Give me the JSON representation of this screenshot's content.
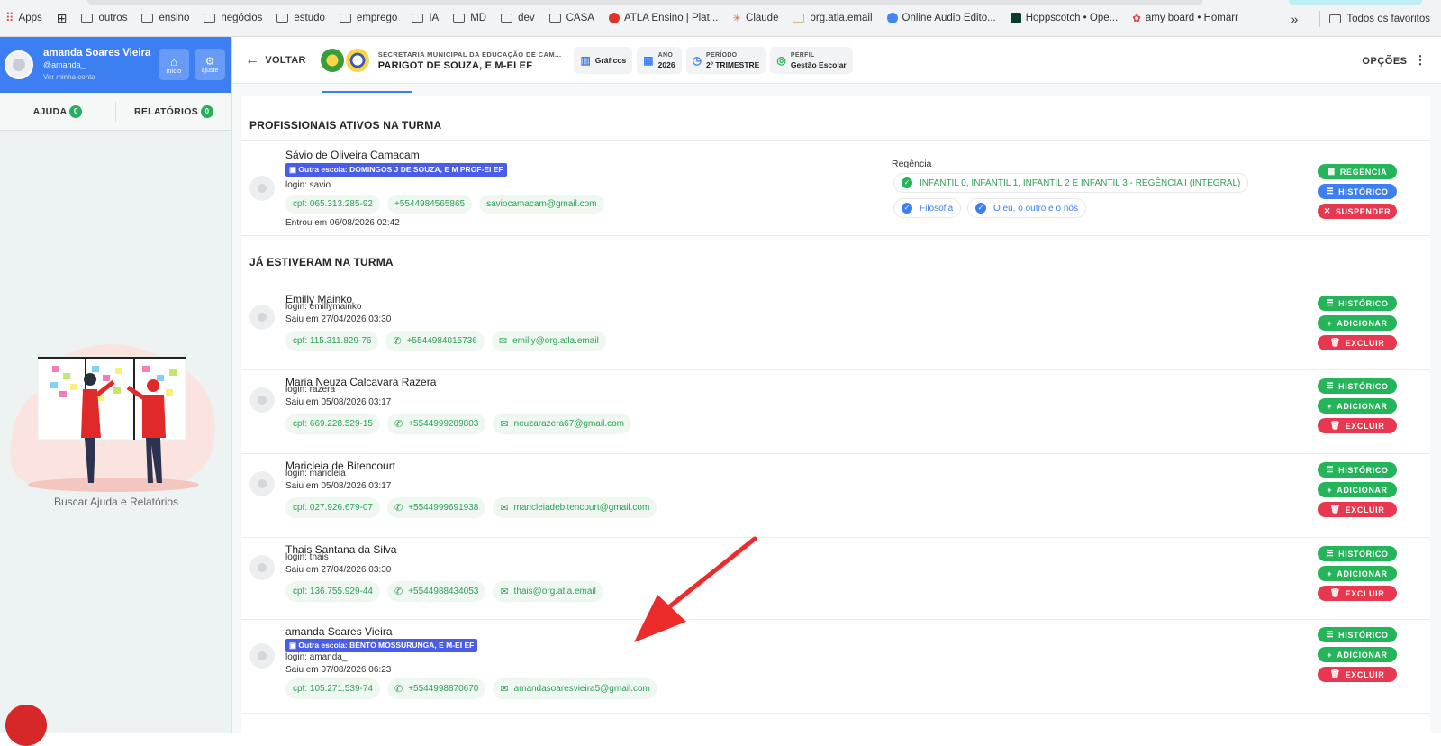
{
  "bookmarks": {
    "items": [
      {
        "label": "Apps",
        "icon": "apps-grid-icon"
      },
      {
        "label": "",
        "icon": "tab-groups-icon"
      },
      {
        "label": "outros",
        "icon": "folder-icon"
      },
      {
        "label": "ensino",
        "icon": "folder-icon"
      },
      {
        "label": "negócios",
        "icon": "folder-icon"
      },
      {
        "label": "estudo",
        "icon": "folder-icon"
      },
      {
        "label": "emprego",
        "icon": "folder-icon"
      },
      {
        "label": "IA",
        "icon": "folder-icon"
      },
      {
        "label": "MD",
        "icon": "folder-icon"
      },
      {
        "label": "dev",
        "icon": "folder-icon"
      },
      {
        "label": "CASA",
        "icon": "folder-icon"
      },
      {
        "label": "ATLA Ensino | Plat...",
        "icon": "atla-favicon"
      },
      {
        "label": "Claude",
        "icon": "claude-favicon"
      },
      {
        "label": "org.atla.email",
        "icon": "mail-favicon"
      },
      {
        "label": "Online Audio Edito...",
        "icon": "audio-favicon"
      },
      {
        "label": "Hoppscotch • Ope...",
        "icon": "hoppscotch-favicon"
      },
      {
        "label": "amy board • Homarr",
        "icon": "homarr-favicon"
      }
    ],
    "overflow": "»",
    "all_favorites": "Todos os favoritos"
  },
  "sidebar": {
    "user_name": "amanda Soares Vieira",
    "user_handle": "@amanda_",
    "view_account": "Ver minha conta",
    "home_label": "início",
    "settings_label": "ajuste",
    "tabs": [
      {
        "label": "AJUDA",
        "count": "0"
      },
      {
        "label": "RELATÓRIOS",
        "count": "0"
      }
    ],
    "footer": "Buscar Ajuda e Relatórios"
  },
  "topbar": {
    "back_label": "VOLTAR",
    "secretaria": "SECRETARIA MUNICIPAL DA EDUCAÇÃO DE CAM...",
    "school": "PARIGOT DE SOUZA, E M-EI EF",
    "graficos": "Gráficos",
    "ano_label": "ANO",
    "ano_value": "2026",
    "periodo_label": "PERÍODO",
    "periodo_value": "2º TRIMESTRE",
    "perfil_label": "PERFIL",
    "perfil_value": "Gestão Escolar",
    "opcoes": "OPÇÕES"
  },
  "colors": {
    "accent": "#3d7ff2",
    "success": "#25b45a",
    "danger": "#e8384f",
    "school_tag": "#4a5de8"
  },
  "active": {
    "title": "PROFISSIONAIS ATIVOS NA TURMA",
    "person": {
      "name": "Sávio de Oliveira Camacam",
      "school": "Outra escola: DOMINGOS J DE SOUZA, E M PROF-EI EF",
      "login": "login: savio",
      "cpf": "cpf: 065.313.285-92",
      "phone": "+5544984565865",
      "email": "saviocamacam@gmail.com",
      "entered": "Entrou em 06/08/2026 02:42",
      "regencia_label": "Regência",
      "regencia_turmas": "INFANTIL 0, INFANTIL 1, INFANTIL 2 E INFANTIL 3 - REGÊNCIA I (INTEGRAL)",
      "subjects": [
        "Filosofia",
        "O eu, o outro e o nós"
      ],
      "buttons": [
        "REGÊNCIA",
        "HISTÓRICO",
        "SUSPENDER"
      ]
    }
  },
  "former": {
    "title": "JÁ ESTIVERAM NA TURMA",
    "buttons": [
      "HISTÓRICO",
      "ADICIONAR",
      "EXCLUIR"
    ],
    "people": [
      {
        "name": "Emilly Mainko",
        "login": "login: emillymainko",
        "left": "Saiu em 27/04/2026 03:30",
        "cpf": "cpf: 115.311.829-76",
        "phone": "+5544984015736",
        "email": "emilly@org.atla.email"
      },
      {
        "name": "Maria Neuza Calcavara Razera",
        "login": "login: razera",
        "left": "Saiu em 05/08/2026 03:17",
        "cpf": "cpf: 669.228.529-15",
        "phone": "+5544999289803",
        "email": "neuzarazera67@gmail.com"
      },
      {
        "name": "Maricleia de Bitencourt",
        "login": "login: maricleia",
        "left": "Saiu em 05/08/2026 03:17",
        "cpf": "cpf: 027.926.679-07",
        "phone": "+5544999691938",
        "email": "maricleiadebitencourt@gmail.com"
      },
      {
        "name": "Thais Santana da Silva",
        "login": "login: thais",
        "left": "Saiu em 27/04/2026 03:30",
        "cpf": "cpf: 136.755.929-44",
        "phone": "+5544988434053",
        "email": "thais@org.atla.email"
      },
      {
        "name": "amanda Soares Vieira",
        "school": "Outra escola: BENTO MOSSURUNGA, E M-EI EF",
        "login": "login: amanda_",
        "left": "Saiu em 07/08/2026 06:23",
        "cpf": "cpf: 105.271.539-74",
        "phone": "+5544998870670",
        "email": "amandasoaresvieira5@gmail.com"
      }
    ]
  }
}
